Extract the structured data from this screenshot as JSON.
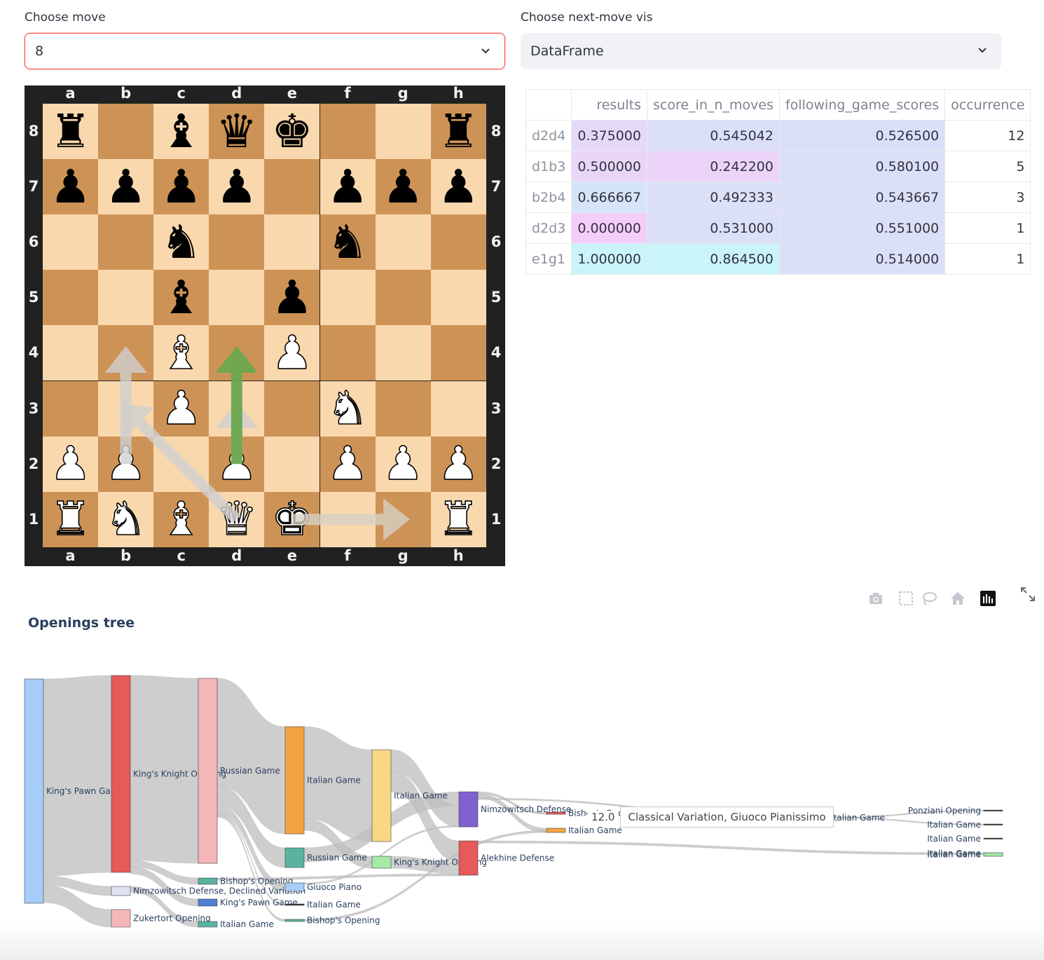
{
  "controls": {
    "move_label": "Choose move",
    "move_value": "8",
    "vis_label": "Choose next-move vis",
    "vis_value": "DataFrame"
  },
  "board": {
    "files": [
      "a",
      "b",
      "c",
      "d",
      "e",
      "f",
      "g",
      "h"
    ],
    "ranks": [
      "8",
      "7",
      "6",
      "5",
      "4",
      "3",
      "2",
      "1"
    ],
    "rows": [
      [
        "br",
        "",
        "bb",
        "bq",
        "bk",
        "",
        "",
        "br"
      ],
      [
        "bp",
        "bp",
        "bp",
        "bp",
        "",
        "bp",
        "bp",
        "bp"
      ],
      [
        "",
        "",
        "bn",
        "",
        "",
        "bn",
        "",
        ""
      ],
      [
        "",
        "",
        "bb",
        "",
        "bp",
        "",
        "",
        ""
      ],
      [
        "",
        "",
        "wb",
        "",
        "wp",
        "",
        "",
        ""
      ],
      [
        "",
        "",
        "wp",
        "",
        "",
        "wn",
        "",
        ""
      ],
      [
        "wp",
        "wp",
        "",
        "wp",
        "",
        "wp",
        "wp",
        "wp"
      ],
      [
        "wr",
        "wn",
        "wb",
        "wq",
        "wk",
        "",
        "",
        "wr"
      ]
    ],
    "arrows": [
      {
        "from": "d2",
        "to": "d4",
        "color": "#6aa84f"
      },
      {
        "from": "d1",
        "to": "b3",
        "color": "#cfcfcf"
      },
      {
        "from": "b2",
        "to": "b4",
        "color": "#cfcfcf"
      },
      {
        "from": "d2",
        "to": "d3",
        "color": "#cfcfcf"
      },
      {
        "from": "e1",
        "to": "g1",
        "color": "#d8cfc4"
      }
    ]
  },
  "table": {
    "columns": [
      "",
      "results",
      "score_in_n_moves",
      "following_game_scores",
      "occurrence"
    ],
    "rows": [
      {
        "idx": "d2d4",
        "results": "0.375000",
        "score": "0.545042",
        "following": "0.526500",
        "occurrence": "12",
        "c1": "#e6d9f8",
        "c2": "#dbe0f8",
        "c3": "#dbe0f8"
      },
      {
        "idx": "d1b3",
        "results": "0.500000",
        "score": "0.242200",
        "following": "0.580100",
        "occurrence": "5",
        "c1": "#e9d6f7",
        "c2": "#ecd3f8",
        "c3": "#dbe0f8"
      },
      {
        "idx": "b2b4",
        "results": "0.666667",
        "score": "0.492333",
        "following": "0.543667",
        "occurrence": "3",
        "c1": "#d6e4f8",
        "c2": "#dde1f8",
        "c3": "#dbe0f8"
      },
      {
        "idx": "d2d3",
        "results": "0.000000",
        "score": "0.531000",
        "following": "0.551000",
        "occurrence": "1",
        "c1": "#f4cdf8",
        "c2": "#dbe0f8",
        "c3": "#dbe0f8"
      },
      {
        "idx": "e1g1",
        "results": "1.000000",
        "score": "0.864500",
        "following": "0.514000",
        "occurrence": "1",
        "c1": "#c9f4fa",
        "c2": "#c9f4fa",
        "c3": "#dbe0f8"
      }
    ]
  },
  "tree": {
    "title": "Openings tree",
    "tooltip_value": "12.0",
    "tooltip_text": "Classical Variation, Giuoco Pianissimo",
    "nodes": [
      {
        "label": "King's Pawn Game",
        "color": "#a6cdf9"
      },
      {
        "label": "King's Knight Opening",
        "color": "#e8595a"
      },
      {
        "label": "Nimzowitsch Defense, Declined Variation",
        "color": "#dde3ef"
      },
      {
        "label": "Zukertort Opening",
        "color": "#f4b6b6"
      },
      {
        "label": "Russian Game",
        "color": "#f4b6b6"
      },
      {
        "label": "Bishop's Opening",
        "color": "#59b3a0"
      },
      {
        "label": "King's Pawn Game",
        "color": "#4f7fd0"
      },
      {
        "label": "Italian Game",
        "color": "#59b3a0"
      },
      {
        "label": "Italian Game",
        "color": "#f3a442"
      },
      {
        "label": "Russian Game",
        "color": "#59b3a0"
      },
      {
        "label": "Giuoco Piano",
        "color": "#a6cdf9"
      },
      {
        "label": "Italian Game",
        "color": "#333333"
      },
      {
        "label": "Bishop's Opening",
        "color": "#59b3a0"
      },
      {
        "label": "Italian Game",
        "color": "#f8d887"
      },
      {
        "label": "King's Knight Opening",
        "color": "#a4eaa6"
      },
      {
        "label": "Nimzowitsch Defense",
        "color": "#8061cf"
      },
      {
        "label": "Alekhine Defense",
        "color": "#e8595a"
      },
      {
        "label": "Bishop's Opening",
        "color": "#e8595a"
      },
      {
        "label": "Italian Game",
        "color": "#f3a442"
      },
      {
        "label": "Italian Game",
        "color": "#333333"
      },
      {
        "label": "Ponziani Opening",
        "color": "#333333"
      },
      {
        "label": "Italian Game",
        "color": "#333333"
      },
      {
        "label": "Italian Game",
        "color": "#333333"
      },
      {
        "label": "Italian Game",
        "color": "#333333"
      },
      {
        "label": "Italian Game",
        "color": "#a4eaa6"
      }
    ]
  },
  "toolbar": {
    "icons": [
      "camera-icon",
      "box-select-icon",
      "lasso-icon",
      "home-icon",
      "plotly-logo-icon",
      "fullscreen-icon"
    ]
  }
}
